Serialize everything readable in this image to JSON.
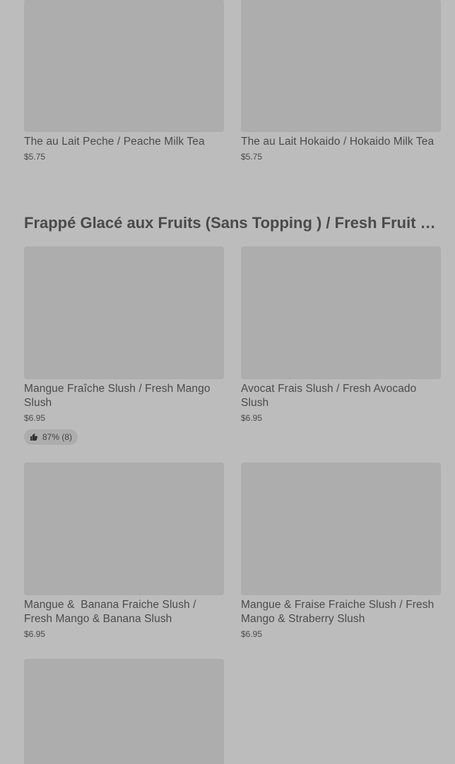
{
  "products_top": [
    {
      "name": "The au Lait Peche / Peache Milk Tea",
      "price": "$5.75"
    },
    {
      "name": "The au Lait Hokaido / Hokaido Milk Tea",
      "price": "$5.75"
    }
  ],
  "section": {
    "title": "Frappé Glacé aux Fruits (Sans Topping ) / Fresh Fruit Slush (No Topping)"
  },
  "products_section": [
    {
      "name": "Mangue Fraîche Slush / Fresh Mango Slush",
      "price": "$6.95",
      "rating": "87% (8)"
    },
    {
      "name": "Avocat Frais Slush / Fresh Avocado Slush",
      "price": "$6.95"
    },
    {
      "name": "Mangue &  Banana Fraiche Slush / Fresh Mango & Banana Slush",
      "price": "$6.95"
    },
    {
      "name": "Mangue & Fraise Fraiche Slush / Fresh Mango & Straberry Slush",
      "price": "$6.95"
    }
  ],
  "icons": {
    "rating_icon": "thumbs-up-icon"
  }
}
